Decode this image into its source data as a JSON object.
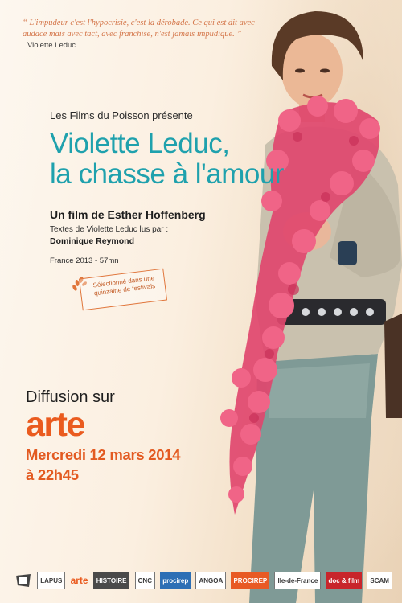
{
  "quote": {
    "text": "“ L'impudeur c'est l'hypocrisie, c'est la dérobade. Ce qui est dit avec audace mais avec tact, avec franchise, n'est jamais impudique. ”",
    "author": "Violette Leduc"
  },
  "presents": "Les Films du Poisson présente",
  "title_line1": "Violette Leduc,",
  "title_line2": "la chasse à l'amour",
  "byline": "Un film de Esther Hoffenberg",
  "texts_label": "Textes de Violette Leduc lus par :",
  "reader": "Dominique Reymond",
  "meta": "France 2013 - 57mn",
  "festival": "Sélectionné dans une quinzaine de festivals",
  "broadcast": {
    "label": "Diffusion sur",
    "channel": "arte",
    "date": "Mercredi 12 mars 2014",
    "time": "à 22h45"
  },
  "logos": [
    "LAPUS",
    "arte",
    "HISTOIRE",
    "CNC",
    "procirep",
    "ANGOA",
    "PROCIREP",
    "Ile-de-France",
    "doc & film",
    "SCAM"
  ],
  "colors": {
    "title": "#1fa1ad",
    "accent": "#ea5b1f",
    "boa": "#e0476e"
  }
}
